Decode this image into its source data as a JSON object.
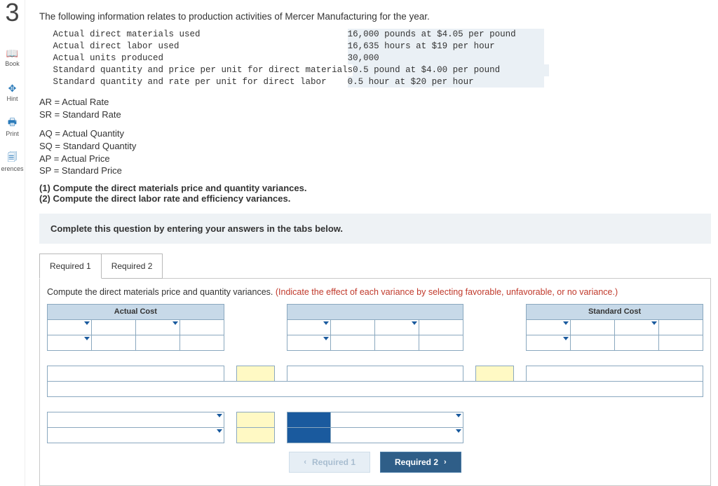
{
  "sidebar": {
    "number": "3",
    "items": [
      {
        "label": "Book",
        "icon": "📖"
      },
      {
        "label": "Hint",
        "icon": "✥"
      },
      {
        "label": "Print",
        "icon": "🖶"
      },
      {
        "label": "erences",
        "icon": "🗐"
      }
    ]
  },
  "intro": "The following information relates to production activities of Mercer Manufacturing for the year.",
  "data_rows": [
    {
      "label": "Actual direct materials used",
      "value": "16,000 pounds at $4.05 per pound"
    },
    {
      "label": "Actual direct labor used",
      "value": "16,635 hours at $19 per hour"
    },
    {
      "label": "Actual units produced",
      "value": "30,000"
    },
    {
      "label": "Standard quantity and price per unit for direct materials",
      "value": "0.5 pound at $4.00 per pound"
    },
    {
      "label": "Standard quantity and rate per unit for direct labor",
      "value": "0.5 hour at $20 per hour"
    }
  ],
  "legend_block1": [
    "AR = Actual Rate",
    "SR = Standard Rate"
  ],
  "legend_block2": [
    "AQ = Actual Quantity",
    "SQ = Standard Quantity",
    "AP = Actual Price",
    "SP = Standard Price"
  ],
  "tasks": [
    "(1) Compute the direct materials price and quantity variances.",
    "(2) Compute the direct labor rate and efficiency variances."
  ],
  "instruction_banner": "Complete this question by entering your answers in the tabs below.",
  "tabs": {
    "t1": "Required 1",
    "t2": "Required 2"
  },
  "panel_prompt": {
    "black": "Compute the direct materials price and quantity variances. ",
    "red": "(Indicate the effect of each variance by selecting favorable, unfavorable, or no variance.)"
  },
  "headers": {
    "actual": "Actual Cost",
    "standard": "Standard Cost"
  },
  "nav": {
    "prev": "Required 1",
    "next": "Required 2"
  }
}
